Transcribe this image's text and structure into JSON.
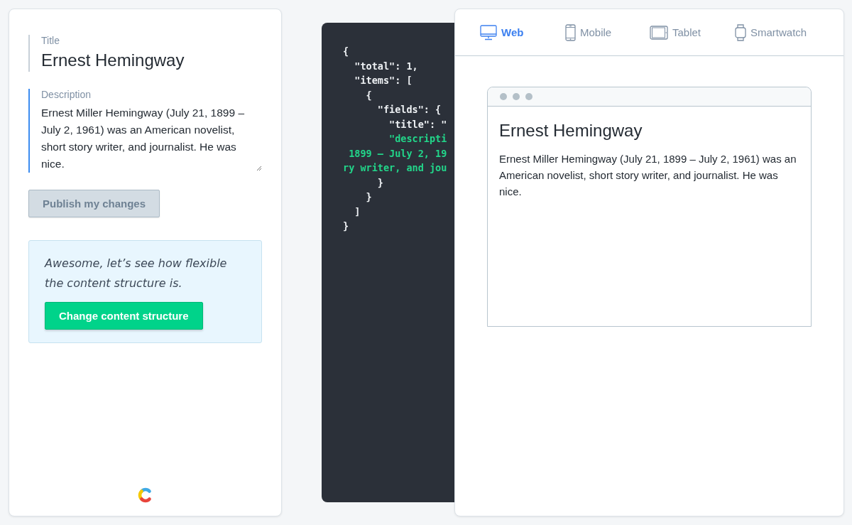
{
  "editor": {
    "fields": [
      {
        "label": "Title",
        "value": "Ernest Hemingway",
        "kind": "title",
        "focused": false
      },
      {
        "label": "Description",
        "value": "Ernest Miller Hemingway (July 21, 1899 – July 2, 1961) was an American novelist, short story writer, and journalist. He was nice.",
        "kind": "textarea",
        "focused": true
      }
    ],
    "publish_button": {
      "label": "Publish my changes",
      "disabled": true
    },
    "callout": {
      "text": "Awesome, let’s see how flexible the content structure is.",
      "button": "Change content structure"
    }
  },
  "code": {
    "lines": [
      {
        "text": "{",
        "kind": "plain"
      },
      {
        "text": "  \"total\": 1,",
        "kind": "plain"
      },
      {
        "text": "  \"items\": [",
        "kind": "plain"
      },
      {
        "text": "    {",
        "kind": "plain"
      },
      {
        "text": "      \"fields\": {",
        "kind": "plain"
      },
      {
        "text": "        \"title\": \"",
        "kind": "plain"
      },
      {
        "text": "        \"descripti",
        "kind": "string"
      },
      {
        "text": " 1899 – July 2, 19",
        "kind": "string"
      },
      {
        "text": "ry writer, and jou",
        "kind": "string"
      },
      {
        "text": "      }",
        "kind": "plain"
      },
      {
        "text": "    }",
        "kind": "plain"
      },
      {
        "text": "  ]",
        "kind": "plain"
      },
      {
        "text": "}",
        "kind": "plain"
      }
    ]
  },
  "preview": {
    "tabs": [
      {
        "label": "Web",
        "kind": "web",
        "selected": true
      },
      {
        "label": "Mobile",
        "kind": "mobile",
        "selected": false
      },
      {
        "label": "Tablet",
        "kind": "tablet",
        "selected": false
      },
      {
        "label": "Smartwatch",
        "kind": "watch",
        "selected": false
      }
    ],
    "title": "Ernest Hemingway",
    "body": "Ernest Miller Hemingway (July 21, 1899 – July 2, 1961) was an American novelist, short story writer, and journalist. He was nice."
  }
}
